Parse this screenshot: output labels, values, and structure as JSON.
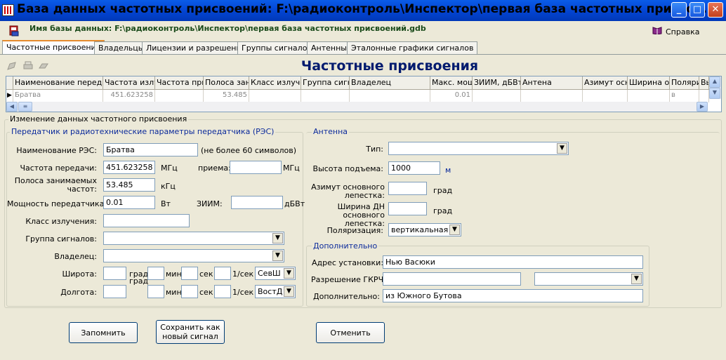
{
  "window": {
    "title": "База данных частотных присвоений: F:\\радиоконтроль\\Инспектор\\первая база частотных присвое...",
    "minimize": "_",
    "maximize": "□",
    "close": "✕"
  },
  "info": {
    "db_label": "Имя базы данных: F:\\радиоконтроль\\Инспектор\\первая база частотных присвоений.gdb",
    "help": "Справка"
  },
  "tabs": [
    "Частотные присвоения",
    "Владельцы",
    "Лицензии и разрешения",
    "Группы сигналов",
    "Антенны",
    "Эталонные графики сигналов"
  ],
  "grid": {
    "title": "Частотные присвоения",
    "headers": [
      "Наименование передат",
      "Частота излу",
      "Частота при",
      "Полоса зан",
      "Класс излучен",
      "Группа сигна",
      "Владелец",
      "Макс. мощ",
      "ЗИИМ, дБВт",
      "Антена",
      "Азимут осно",
      "Ширина осн",
      "Поляри",
      "Вь"
    ],
    "row": [
      "Братва",
      "451.623258",
      "",
      "53.485",
      "",
      "",
      "",
      "0.01",
      "",
      "",
      "",
      "",
      "в",
      ""
    ]
  },
  "edit_group": "Изменение данных частотного присвоения",
  "transmitter": {
    "legend": "Передатчик и радиотехнические параметры передатчика (РЭС)",
    "name_label": "Наименование РЭС:",
    "name_value": "Братва",
    "name_hint": "(не более 60 символов)",
    "tx_freq_label": "Частота передачи:",
    "tx_freq_value": "451.623258",
    "mhz": "МГц",
    "rx_label": "приема:",
    "rx_value": "",
    "bw_label": "Полоса занимаемых частот:",
    "bw_value": "53.485",
    "khz": "кГц",
    "power_label": "Мощность передатчика:",
    "power_value": "0.01",
    "watt": "Вт",
    "eirp_label": "ЗИИМ:",
    "eirp_value": "",
    "dbw": "дБВт",
    "class_label": "Класс излучения:",
    "class_value": "",
    "group_label": "Группа сигналов:",
    "group_value": "",
    "owner_label": "Владелец:",
    "owner_value": "",
    "lat_label": "Широта:",
    "lon_label": "Долгота:",
    "deg": "град",
    "min": "мин",
    "sec": "сек",
    "per_sec": "1/сек",
    "lat_dir": "СевШ",
    "lon_dir": "ВостД"
  },
  "antenna": {
    "legend": "Антенна",
    "type_label": "Тип:",
    "type_value": "",
    "height_label": "Высота подъема:",
    "height_value": "1000",
    "height_unit": "м",
    "azimuth_label": "Азимут основного лепестка:",
    "azimuth_value": "",
    "width_label": "Ширина ДН основного лепестка:",
    "width_value": "",
    "deg": "град",
    "pol_label": "Поляризация:",
    "pol_value": "вертикальная"
  },
  "extra": {
    "legend": "Дополнительно",
    "address_label": "Адрес установки:",
    "address_value": "Нью Васюки",
    "permit_label": "Разрешение ГКРЧ:",
    "permit_value": "",
    "permit_select": "",
    "extra_label": "Дополнительно:",
    "extra_value": "из Южного Бутова"
  },
  "buttons": {
    "remember": "Запомнить",
    "save_new_line1": "Сохранить как",
    "save_new_line2": "новый сигнал",
    "cancel": "Отменить"
  }
}
